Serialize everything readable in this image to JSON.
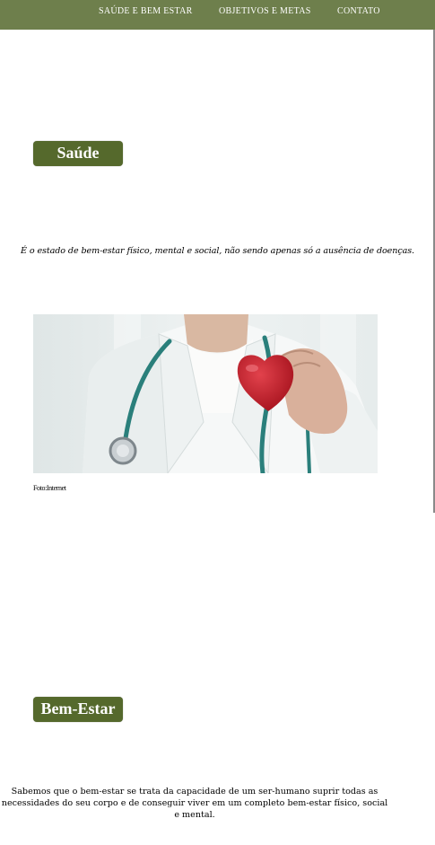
{
  "nav": {
    "items": [
      {
        "label": "SAÚDE E BEM ESTAR"
      },
      {
        "label": "OBJETIVOS E METAS"
      },
      {
        "label": "CONTATO"
      }
    ]
  },
  "saude": {
    "title": "Saúde",
    "definition": "É o estado de bem-estar físico, mental e social, não sendo apenas só a ausência de doenças.",
    "image_caption": "Foto:Internet"
  },
  "bem_estar": {
    "title": "Bem-Estar",
    "text": "Sabemos que o bem-estar se trata da capacidade de um ser-humano suprir todas as necessidades do seu corpo e de conseguir viver em um completo bem-estar físico, social e mental."
  },
  "colors": {
    "navbar": "#6e7f4c",
    "badge": "#55692c",
    "heart": "#c8202c",
    "stethoscope": "#2a7f7b"
  }
}
